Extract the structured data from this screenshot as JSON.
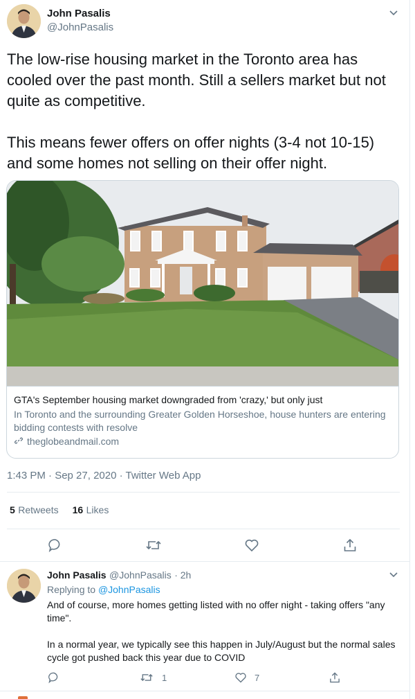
{
  "tweet": {
    "author_name": "John Pasalis",
    "author_handle": "@JohnPasalis",
    "text": "The low-rise housing market in the Toronto area has cooled over the past month.  Still a sellers market but not quite as competitive.\n\nThis means fewer offers on offer nights (3-4 not 10-15) and some homes not selling on their offer night.",
    "card": {
      "title": "GTA's September housing market downgraded from 'crazy,' but only just",
      "description": "In Toronto and the surrounding Greater Golden Horseshoe, house hunters are entering bidding contests with resolve",
      "domain": "theglobeandmail.com"
    },
    "timestamp": "1:43 PM · Sep 27, 2020 · Twitter Web App",
    "retweets_count": "5",
    "retweets_label": "Retweets",
    "likes_count": "16",
    "likes_label": "Likes"
  },
  "reply": {
    "author_name": "John Pasalis",
    "author_handle": "@JohnPasalis",
    "time": "· 2h",
    "replying_prefix": "Replying to",
    "replying_handle": "@JohnPasalis",
    "text": "And of course, more homes getting listed with no offer night - taking offers \"any time\".\n\nIn a normal year, we typically see this happen in July/August but the normal sales cycle got pushed back this year due to COVID",
    "retweet_count": "1",
    "like_count": "7"
  },
  "colors": {
    "link": "#1b95e0",
    "muted": "#657786",
    "divider": "#e6ecf0"
  }
}
